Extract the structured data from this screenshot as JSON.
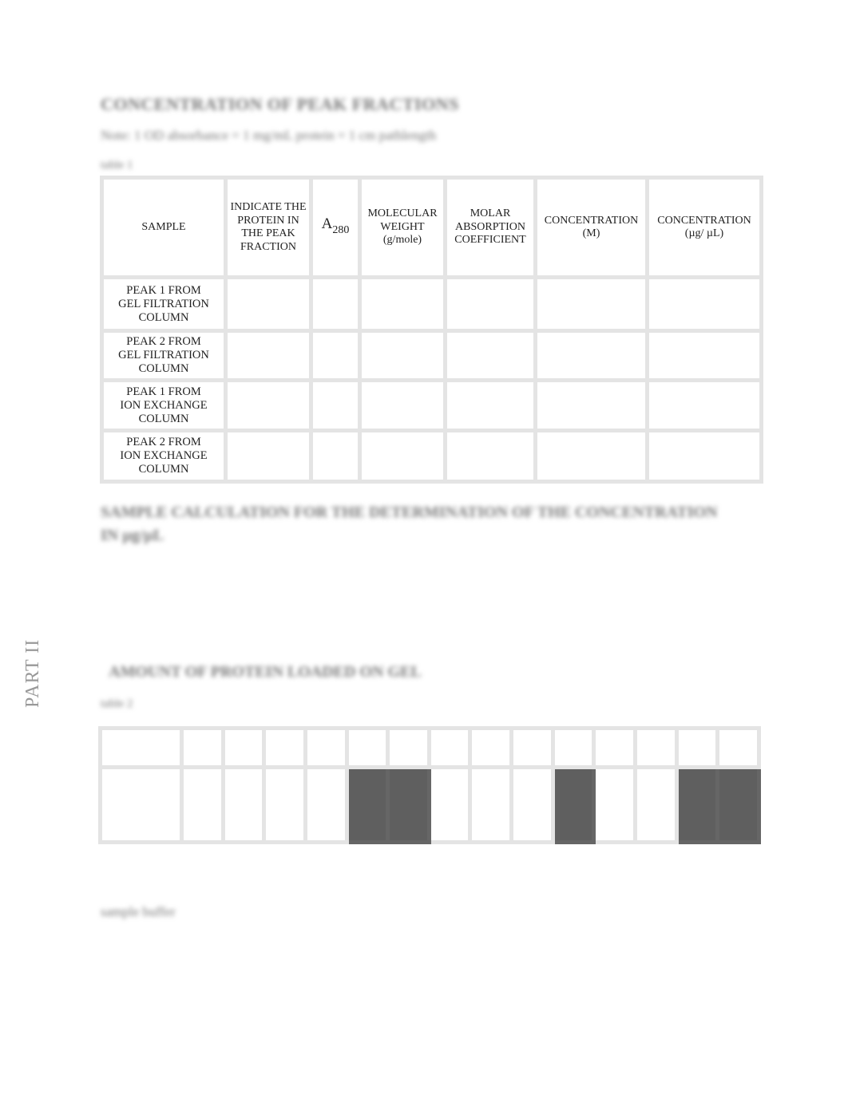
{
  "part1": {
    "title": "CONCENTRATION OF PEAK FRACTIONS",
    "subtitle": "Note: 1 OD absorbance = 1 mg/mL protein = 1 cm pathlength",
    "table_label": "table 1",
    "table": {
      "headers": {
        "sample": "SAMPLE",
        "protein": "INDICATE THE PROTEIN IN THE PEAK FRACTION",
        "a280_main": "A",
        "a280_sub": "280",
        "mw_line1": "MOLECULAR WEIGHT",
        "mw_line2": "(g/mole)",
        "molar_abs": "MOLAR ABSORPTION COEFFICIENT",
        "conc_m_line1": "CONCENTRATION",
        "conc_m_line2": "(M)",
        "conc_ug_line1": "CONCENTRATION",
        "conc_ug_line2": "(µg/ µL)"
      },
      "rows": [
        {
          "sample": [
            "PEAK 1 FROM",
            "GEL  FILTRATION",
            "COLUMN"
          ],
          "protein": "",
          "a280": "",
          "mw": "",
          "molar_abs": "",
          "conc_m": "",
          "conc_ug": ""
        },
        {
          "sample": [
            "PEAK 2 FROM",
            "GEL  FILTRATION",
            "COLUMN"
          ],
          "protein": "",
          "a280": "",
          "mw": "",
          "molar_abs": "",
          "conc_m": "",
          "conc_ug": ""
        },
        {
          "sample": [
            "PEAK 1 FROM",
            "ION EXCHANGE",
            "COLUMN"
          ],
          "protein": "",
          "a280": "",
          "mw": "",
          "molar_abs": "",
          "conc_m": "",
          "conc_ug": ""
        },
        {
          "sample": [
            "PEAK 2 FROM",
            "ION EXCHANGE",
            "COLUMN"
          ],
          "protein": "",
          "a280": "",
          "mw": "",
          "molar_abs": "",
          "conc_m": "",
          "conc_ug": ""
        }
      ]
    },
    "calculation_heading": "SAMPLE CALCULATION FOR THE DETERMINATION OF THE CONCENTRATION IN µg/µL"
  },
  "part2": {
    "side_label": "PART II",
    "title": "AMOUNT OF PROTEIN LOADED ON GEL",
    "table_label": "table 2",
    "lanes": 14,
    "filled_lanes": [
      5,
      6,
      10,
      13,
      14,
      15
    ],
    "fill_color": "#5f5f5f",
    "buffer_label": "sample buffer"
  }
}
